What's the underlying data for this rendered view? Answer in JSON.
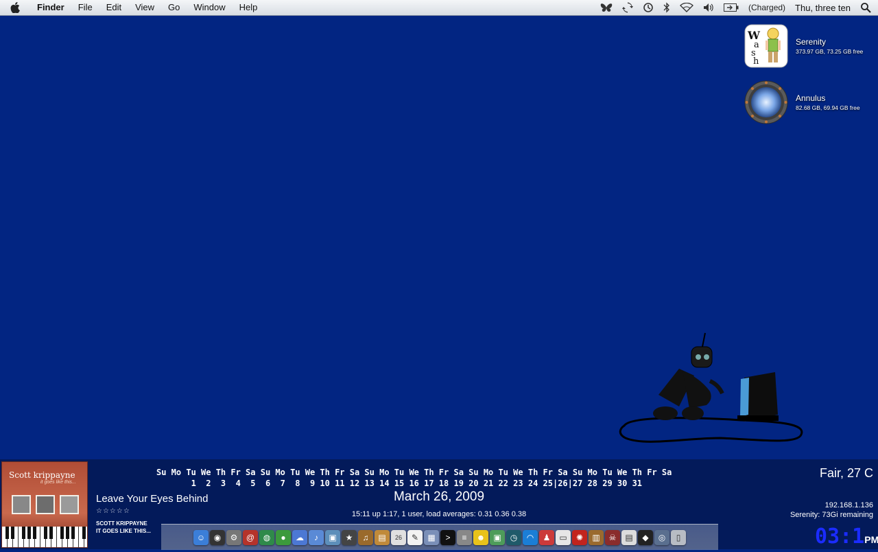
{
  "menubar": {
    "app_name": "Finder",
    "menus": [
      "File",
      "Edit",
      "View",
      "Go",
      "Window",
      "Help"
    ],
    "battery_status": "(Charged)",
    "clock": "Thu, three ten"
  },
  "desktop": {
    "disks": [
      {
        "name": "Serenity",
        "size": "373.97 GB, 73.25 GB free"
      },
      {
        "name": "Annulus",
        "size": "82.68 GB, 69.94 GB free"
      }
    ]
  },
  "itunes": {
    "song": "Leave Your Eyes Behind",
    "rating": "☆☆☆☆☆",
    "artist": "SCOTT KRIPPAYNE",
    "album": "IT GOES LIKE THIS...",
    "cover_artist": "Scott krippayne",
    "cover_subtitle": "it goes like this..."
  },
  "calendar": {
    "days_row": "Su Mo Tu We Th Fr Sa Su Mo Tu We Th Fr Sa Su Mo Tu We Th Fr Sa Su Mo Tu We Th Fr Sa Su Mo Tu We Th Fr Sa",
    "dates_row": "       1  2  3  4  5  6  7  8  9 10 11 12 13 14 15 16 17 18 19 20 21 22 23 24 25|26|27 28 29 30 31",
    "date": "March 26, 2009"
  },
  "system": {
    "uptime": "15:11  up  1:17, 1 user, load averages: 0.31 0.36 0.38",
    "weather": "Fair, 27 C",
    "ip": "192.168.1.136",
    "disk_remaining": "Serenity: 73Gi remaining",
    "clock_time": "03:1",
    "clock_ampm": "PM"
  },
  "colors": {
    "desktop": "#022582",
    "panel": "#031a5a",
    "clock": "#1b2cff"
  },
  "dock": {
    "items": [
      {
        "name": "finder-icon",
        "color": "#3b7ed8",
        "glyph": "☺"
      },
      {
        "name": "dashboard-icon",
        "color": "#333333",
        "glyph": "◉"
      },
      {
        "name": "system-preferences-icon",
        "color": "#777777",
        "glyph": "⚙"
      },
      {
        "name": "address-book-icon",
        "color": "#b5332b",
        "glyph": "@"
      },
      {
        "name": "network-globe-icon",
        "color": "#2f8a4a",
        "glyph": "◍"
      },
      {
        "name": "adium-duck-icon",
        "color": "#3c9a3c",
        "glyph": "●"
      },
      {
        "name": "ichat-icon",
        "color": "#4c78d4",
        "glyph": "☁"
      },
      {
        "name": "itunes-icon",
        "color": "#5a8ad6",
        "glyph": "♪"
      },
      {
        "name": "iphoto-icon",
        "color": "#5d8fba",
        "glyph": "▣"
      },
      {
        "name": "imovie-star-icon",
        "color": "#444444",
        "glyph": "★"
      },
      {
        "name": "garageband-icon",
        "color": "#9a6a2c",
        "glyph": "♫"
      },
      {
        "name": "notebook-icon",
        "color": "#c08a3a",
        "glyph": "▤"
      },
      {
        "name": "ical-icon",
        "color": "#e0e0e0",
        "glyph": "26"
      },
      {
        "name": "textedit-icon",
        "color": "#f2f2f2",
        "glyph": "✎"
      },
      {
        "name": "preview-icon",
        "color": "#7a8fb8",
        "glyph": "▦"
      },
      {
        "name": "terminal-icon",
        "color": "#111111",
        "glyph": ">"
      },
      {
        "name": "activity-monitor-icon",
        "color": "#888888",
        "glyph": "≡"
      },
      {
        "name": "yellow-creature-icon",
        "color": "#e8c21a",
        "glyph": "☻"
      },
      {
        "name": "photo-stack-icon",
        "color": "#4e9c5a",
        "glyph": "▣"
      },
      {
        "name": "time-machine-icon",
        "color": "#1f5a6a",
        "glyph": "◷"
      },
      {
        "name": "wifi-icon",
        "color": "#1b7ed6",
        "glyph": "◠"
      },
      {
        "name": "robot-icon",
        "color": "#cc3a3a",
        "glyph": "♟"
      },
      {
        "name": "document-icon",
        "color": "#e6e6e6",
        "glyph": "▭"
      },
      {
        "name": "virus-icon",
        "color": "#c2241e",
        "glyph": "✺"
      },
      {
        "name": "chest-icon",
        "color": "#9a6a2e",
        "glyph": "▥"
      },
      {
        "name": "pirate-icon",
        "color": "#8a2c2c",
        "glyph": "☠"
      },
      {
        "name": "file-icon",
        "color": "#dcdcdc",
        "glyph": "▤"
      },
      {
        "name": "dark-app-icon",
        "color": "#222222",
        "glyph": "◆"
      },
      {
        "name": "stargate-icon",
        "color": "#5a6f8f",
        "glyph": "◎"
      },
      {
        "name": "trash-icon",
        "color": "#b8bcc4",
        "glyph": "▯"
      }
    ]
  }
}
